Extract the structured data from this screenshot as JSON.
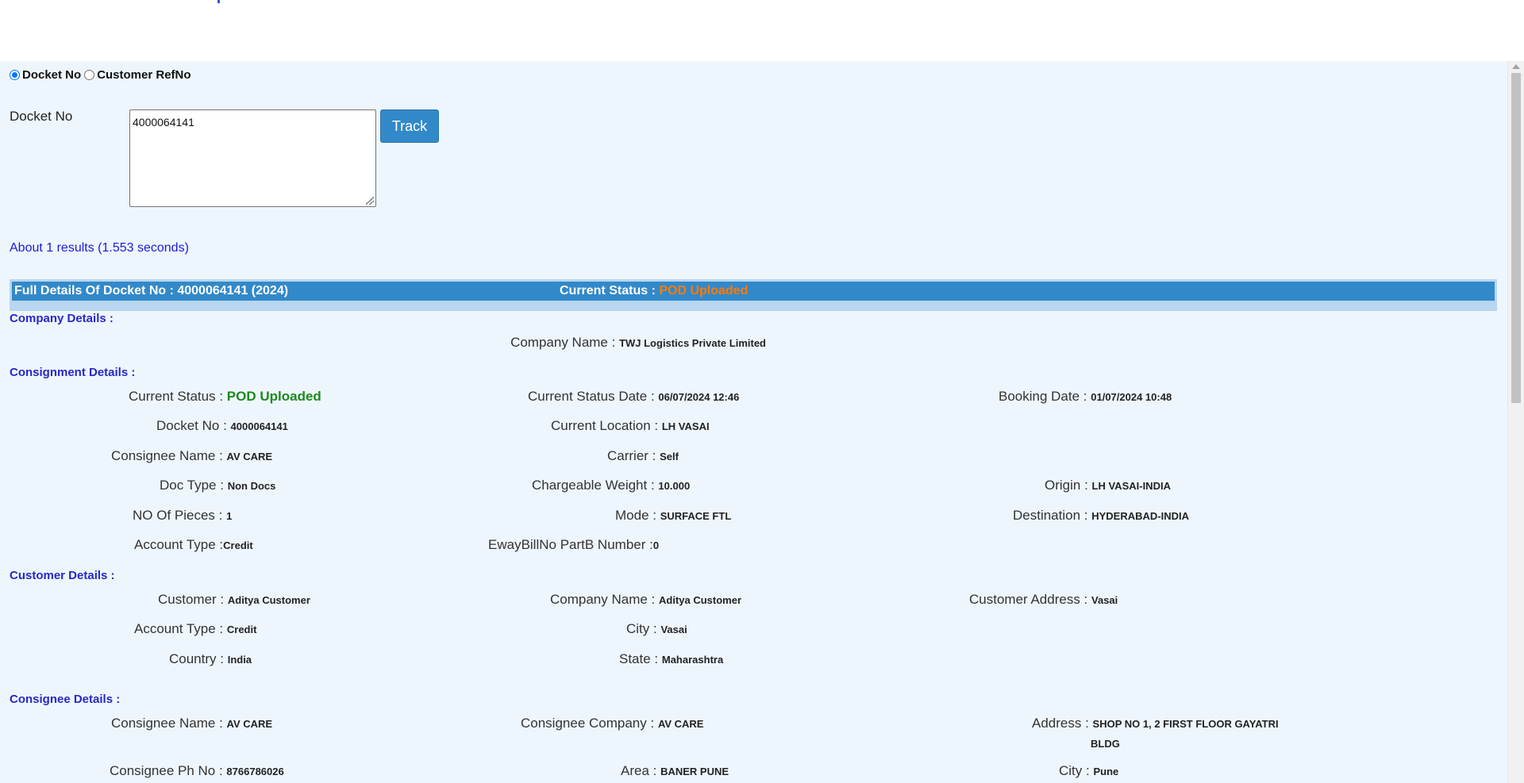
{
  "search": {
    "radio_docket": "Docket No",
    "radio_ref": "Customer RefNo",
    "docket_label": "Docket No",
    "docket_value": "4000064141",
    "track_label": "Track",
    "results_text": "About 1 results (1.553 seconds)"
  },
  "header": {
    "full_details": "Full Details Of Docket No : 4000064141 (2024)",
    "status_label": "Current Status : ",
    "status_value": "POD Uploaded",
    "status_color": "#ff7a00",
    "bar_color": "#3289c9"
  },
  "company": {
    "title": "Company Details :",
    "name_label": "Company Name : ",
    "name_value": "TWJ Logistics Private Limited"
  },
  "consignment": {
    "title": "Consignment Details :",
    "current_status_label": "Current Status : ",
    "current_status_value": "POD Uploaded",
    "current_status_date_label": "Current Status Date : ",
    "current_status_date_value": "06/07/2024 12:46",
    "booking_date_label": "Booking Date : ",
    "booking_date_value": "01/07/2024 10:48",
    "docket_no_label": "Docket No : ",
    "docket_no_value": "4000064141",
    "current_location_label": "Current Location : ",
    "current_location_value": "LH VASAI",
    "consignee_name_label": "Consignee Name : ",
    "consignee_name_value": "AV CARE",
    "carrier_label": "Carrier : ",
    "carrier_value": "Self",
    "doc_type_label": "Doc Type : ",
    "doc_type_value": "Non Docs",
    "chargeable_weight_label": "Chargeable Weight : ",
    "chargeable_weight_value": "10.000",
    "origin_label": "Origin : ",
    "origin_value": "LH VASAI-INDIA",
    "pieces_label": "NO Of Pieces : ",
    "pieces_value": "1",
    "mode_label": "Mode : ",
    "mode_value": "SURFACE FTL",
    "destination_label": "Destination : ",
    "destination_value": "HYDERABAD-INDIA",
    "account_type_label": "Account Type :",
    "account_type_value": "Credit",
    "eway_label": "EwayBillNo PartB Number :",
    "eway_value": "0"
  },
  "customer": {
    "title": "Customer Details :",
    "customer_label": "Customer : ",
    "customer_value": "Aditya Customer",
    "company_name_label": "Company Name : ",
    "company_name_value": "Aditya Customer",
    "address_label": "Customer Address : ",
    "address_value": "Vasai",
    "account_type_label": "Account Type : ",
    "account_type_value": "Credit",
    "city_label": "City : ",
    "city_value": "Vasai",
    "country_label": "Country : ",
    "country_value": "India",
    "state_label": "State : ",
    "state_value": "Maharashtra"
  },
  "consignee": {
    "title": "Consignee Details :",
    "name_label": "Consignee Name : ",
    "name_value": "AV CARE",
    "company_label": "Consignee Company : ",
    "company_value": "AV CARE",
    "address_label": "Address : ",
    "address_line1": "SHOP NO 1, 2 FIRST FLOOR GAYATRI",
    "address_line2": "BLDG",
    "phone_label": "Consignee Ph No : ",
    "phone_value": "8766786026",
    "area_label": "Area : ",
    "area_value": "BANER PUNE",
    "city_label": "City : ",
    "city_value": "Pune"
  }
}
